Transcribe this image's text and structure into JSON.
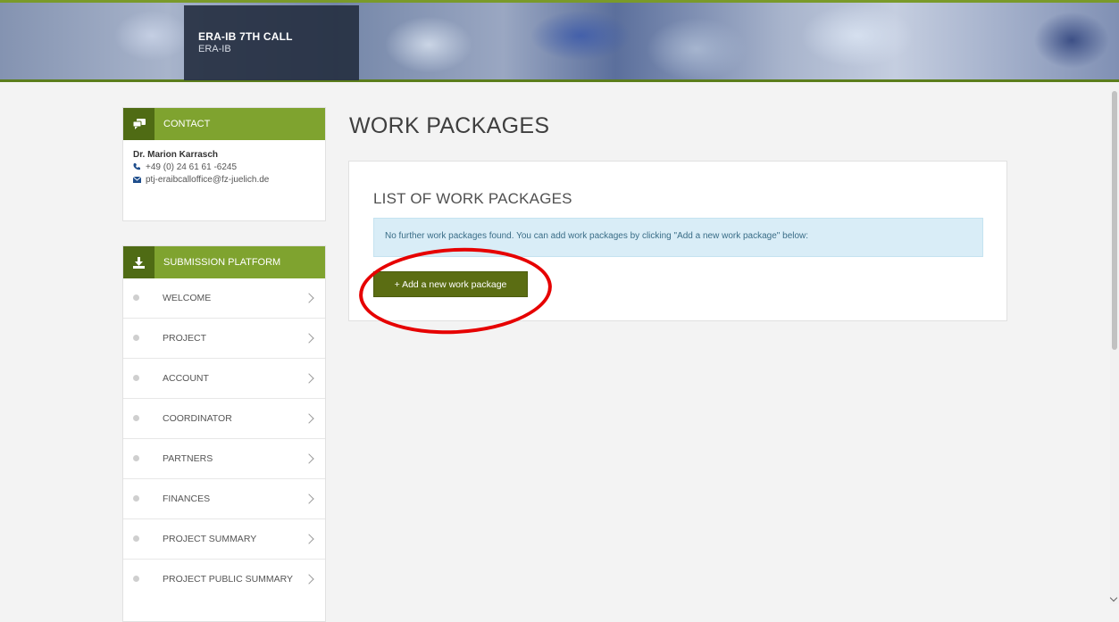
{
  "header": {
    "title": "ERA-IB 7TH CALL",
    "subtitle": "ERA-IB",
    "accent_color": "#7a9a2a"
  },
  "contact": {
    "heading": "CONTACT",
    "name": "Dr. Marion Karrasch",
    "phone": "+49 (0) 24 61 61 -6245",
    "email": "ptj-eraibcalloffice@fz-juelich.de",
    "icons": {
      "heading": "chat-icon",
      "phone": "phone-icon",
      "email": "envelope-icon"
    }
  },
  "submission": {
    "heading": "SUBMISSION PLATFORM",
    "icon": "download-icon",
    "items": [
      {
        "label": "WELCOME"
      },
      {
        "label": "PROJECT"
      },
      {
        "label": "ACCOUNT"
      },
      {
        "label": "COORDINATOR"
      },
      {
        "label": "PARTNERS"
      },
      {
        "label": "FINANCES"
      },
      {
        "label": "PROJECT SUMMARY"
      },
      {
        "label": "PROJECT PUBLIC SUMMARY"
      }
    ]
  },
  "main": {
    "page_title": "WORK PACKAGES",
    "card_title": "LIST OF WORK PACKAGES",
    "info_message": "No further work packages found. You can add work packages by clicking \"Add a new work package\" below:",
    "add_button_label": "+  Add a new work package"
  },
  "colors": {
    "sidebar_header": "#7fa32f",
    "sidebar_icon_box": "#4f6b14",
    "button": "#5b6d13",
    "info_bg": "#d9edf7",
    "highlight": "#e60000"
  }
}
